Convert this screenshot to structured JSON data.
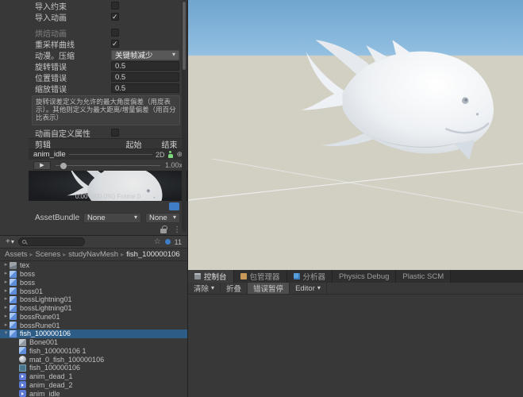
{
  "icons": {
    "caret": "▾",
    "play": "▶",
    "expander_collapsed": "▸",
    "expander_expanded": "▾",
    "kebab": "⋮",
    "star": "☆",
    "axis": "⊕",
    "plus": "+",
    "breadcrumb_sep": "▸"
  },
  "inspector": {
    "import_constraints": {
      "label": "导入约束",
      "checked": false
    },
    "import_animation": {
      "label": "导入动画",
      "checked": true
    },
    "bake_animation": {
      "label": "烘焙动画",
      "checked": false
    },
    "resample_curves": {
      "label": "重采样曲线",
      "checked": true
    },
    "anim_compression": {
      "label": "动漫。压缩",
      "value": "关键帧减少"
    },
    "rotation_error": {
      "label": "旋转错误",
      "value": "0.5"
    },
    "position_error": {
      "label": "位置错误",
      "value": "0.5"
    },
    "scale_error": {
      "label": "缩放错误",
      "value": "0.5"
    },
    "helpbox": "旋转误差定义为允许的最大角度偏差（用度表示）。其他则定义为最大距离/增量偏差（用百分比表示）",
    "custom_properties": {
      "label": "动画自定义属性",
      "checked": false
    }
  },
  "clips": {
    "columns": {
      "clip": "剪辑",
      "start": "起始",
      "end": "结束"
    },
    "clip_name": "anim_idle",
    "mode_2d": "2D",
    "speed": "1.00x",
    "frame_info": "0:00 (000.0%) Frame 0"
  },
  "assetbundle": {
    "label": "AssetBundle",
    "bundle": "None",
    "variant": "None"
  },
  "project": {
    "count_badge": "11",
    "breadcrumb": [
      "Assets",
      "Scenes",
      "studyNavMesh",
      "fish_100000106"
    ],
    "tree": [
      {
        "label": "tex",
        "depth": 0,
        "icon": "texture",
        "expander": "collapsed",
        "selected": false
      },
      {
        "label": "boss",
        "depth": 0,
        "icon": "model",
        "expander": "collapsed",
        "selected": false
      },
      {
        "label": "boss",
        "depth": 0,
        "icon": "model",
        "expander": "collapsed",
        "selected": false
      },
      {
        "label": "boss01",
        "depth": 0,
        "icon": "model",
        "expander": "collapsed",
        "selected": false
      },
      {
        "label": "bossLightning01",
        "depth": 0,
        "icon": "model",
        "expander": "collapsed",
        "selected": false
      },
      {
        "label": "bossLightning01",
        "depth": 0,
        "icon": "model",
        "expander": "collapsed",
        "selected": false
      },
      {
        "label": "bossRune01",
        "depth": 0,
        "icon": "model",
        "expander": "collapsed",
        "selected": false
      },
      {
        "label": "bossRune01",
        "depth": 0,
        "icon": "model",
        "expander": "collapsed",
        "selected": false
      },
      {
        "label": "fish_100000106",
        "depth": 0,
        "icon": "model",
        "expander": "expanded",
        "selected": true
      },
      {
        "label": "Bone001",
        "depth": 1,
        "icon": "gameobject",
        "expander": "none",
        "selected": false
      },
      {
        "label": "fish_100000106 1",
        "depth": 1,
        "icon": "model",
        "expander": "none",
        "selected": false
      },
      {
        "label": "mat_0_fish_100000106",
        "depth": 1,
        "icon": "material",
        "expander": "none",
        "selected": false
      },
      {
        "label": "fish_100000106",
        "depth": 1,
        "icon": "mesh",
        "expander": "none",
        "selected": false
      },
      {
        "label": "anim_dead_1",
        "depth": 1,
        "icon": "anim",
        "expander": "none",
        "selected": false
      },
      {
        "label": "anim_dead_2",
        "depth": 1,
        "icon": "anim",
        "expander": "none",
        "selected": false
      },
      {
        "label": "anim_idle",
        "depth": 1,
        "icon": "anim",
        "expander": "none",
        "selected": false
      }
    ]
  },
  "console": {
    "tabs": [
      {
        "id": "console",
        "label": "控制台",
        "icon": "consoletab",
        "active": true
      },
      {
        "id": "package-manager",
        "label": "包管理器",
        "icon": "package",
        "active": false
      },
      {
        "id": "profiler",
        "label": "分析器",
        "icon": "profiler",
        "active": false
      },
      {
        "id": "physics-debug",
        "label": "Physics Debug",
        "icon": "",
        "active": false
      },
      {
        "id": "plastic-scm",
        "label": "Plastic SCM",
        "icon": "",
        "active": false
      }
    ],
    "toolbar": {
      "clear": "清除",
      "collapse": "折叠",
      "error_pause": "错误暂停",
      "editor": "Editor"
    }
  },
  "scene": {
    "sky_color": "#74a9d2",
    "ground_color": "#d2cfc3",
    "model_color": "#f2f4f6"
  }
}
